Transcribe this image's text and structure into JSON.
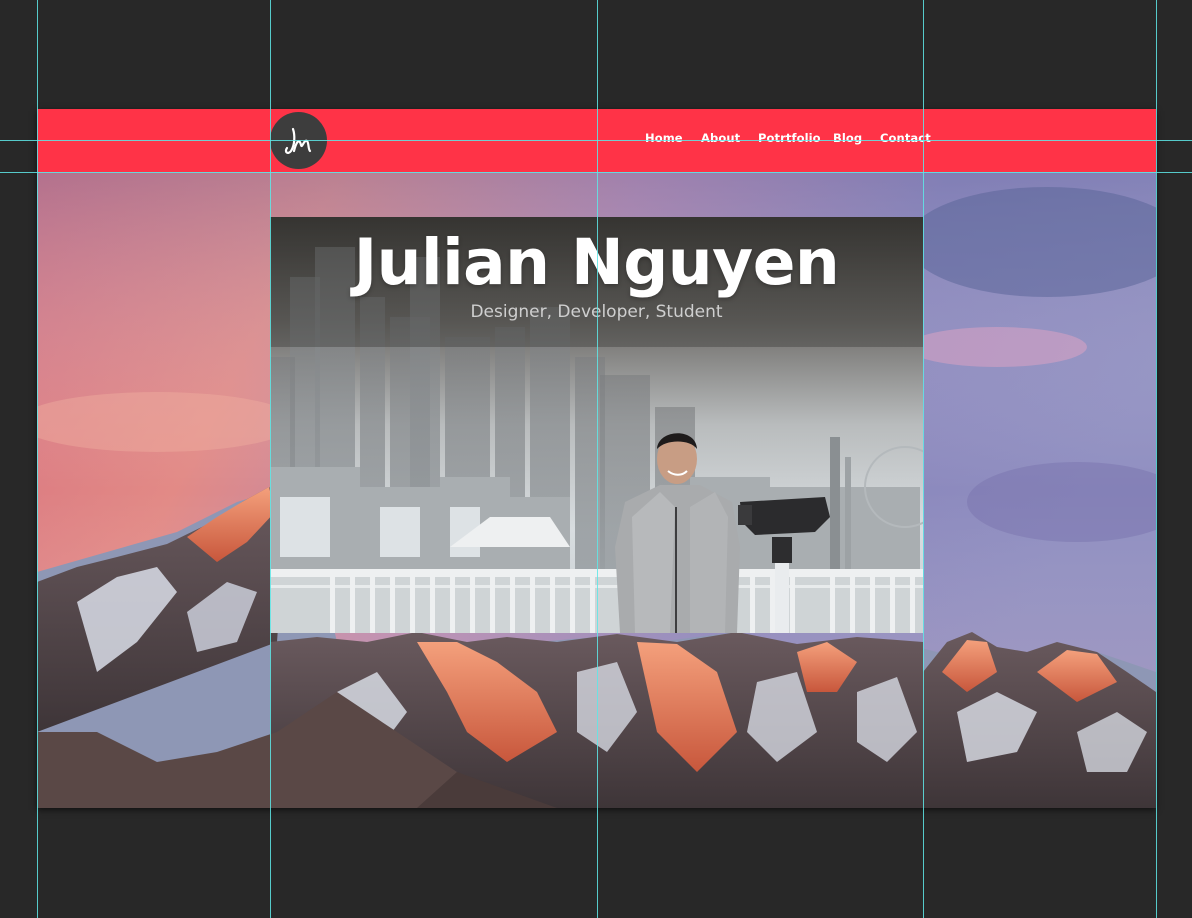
{
  "site": {
    "logo_icon": "jn-monogram-logo",
    "nav": [
      {
        "label": "Home"
      },
      {
        "label": "About"
      },
      {
        "label": "Potrtfolio"
      },
      {
        "label": "Blog"
      },
      {
        "label": "Contact"
      }
    ],
    "hero": {
      "title": "Julian Nguyen",
      "subtitle": "Designer, Developer, Student"
    }
  },
  "colors": {
    "header": "#ff3347",
    "canvas_bg": "#282828",
    "guide": "#5ee8e8",
    "logo_bg": "#3d3d3d"
  }
}
